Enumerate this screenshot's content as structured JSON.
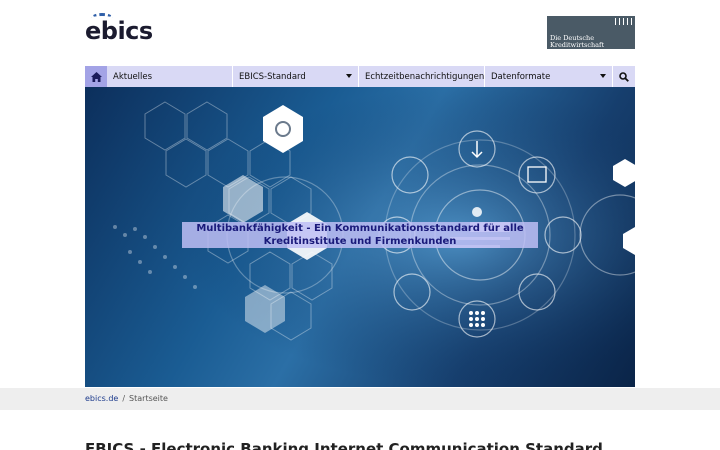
{
  "header": {
    "logo_text": "ebics",
    "partner_line1": "Die Deutsche",
    "partner_line2": "Kreditwirtschaft"
  },
  "nav": {
    "home_icon": "home-icon",
    "items": [
      {
        "label": "Aktuelles"
      },
      {
        "label": "EBICS-Standard"
      },
      {
        "label": "Echtzeitbenachrichtigungen"
      },
      {
        "label": "Datenformate"
      }
    ],
    "search_icon": "search-icon"
  },
  "hero": {
    "caption_line1": "Multibankfähigkeit - Ein Kommunikationsstandard für alle",
    "caption_line2": "Kreditinstitute und Firmenkunden"
  },
  "breadcrumb": {
    "home": "ebics.de",
    "separator": "/",
    "current": "Startseite"
  },
  "main": {
    "title": "EBICS - Electronic Banking Internet Communication Standard"
  },
  "colors": {
    "nav_bg": "#d9d9f5",
    "nav_home_bg": "#a3a3e6",
    "caption_bg": "#bebef5",
    "caption_text": "#1a1a7a",
    "link": "#1d3b8c"
  }
}
